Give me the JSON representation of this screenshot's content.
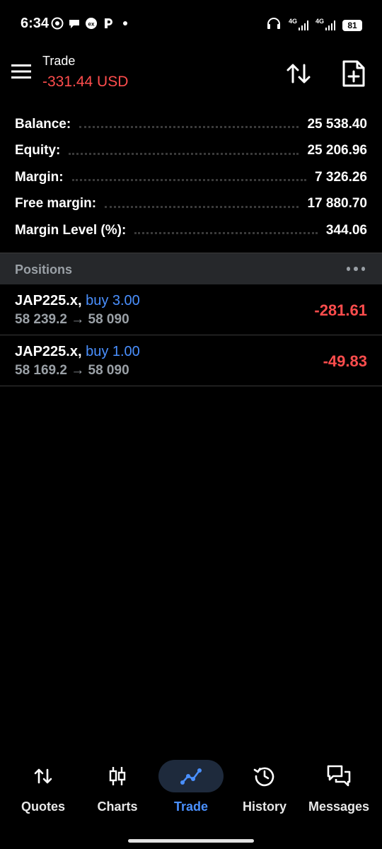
{
  "status_bar": {
    "time": "6:34",
    "net1": "4G",
    "net2": "4G",
    "battery": "81"
  },
  "header": {
    "title": "Trade",
    "profit_loss": "-331.44 USD"
  },
  "account": [
    {
      "label": "Balance:",
      "value": "25 538.40"
    },
    {
      "label": "Equity:",
      "value": "25 206.96"
    },
    {
      "label": "Margin:",
      "value": "7 326.26"
    },
    {
      "label": "Free margin:",
      "value": "17 880.70"
    },
    {
      "label": "Margin Level (%):",
      "value": "344.06"
    }
  ],
  "positions": {
    "title": "Positions",
    "items": [
      {
        "symbol": "JAP225.x,",
        "side": "buy 3.00",
        "prices": "58 239.2 → 58 090",
        "profit": "-281.61"
      },
      {
        "symbol": "JAP225.x,",
        "side": "buy 1.00",
        "prices": "58 169.2 → 58 090",
        "profit": "-49.83"
      }
    ]
  },
  "nav": {
    "quotes": "Quotes",
    "charts": "Charts",
    "trade": "Trade",
    "history": "History",
    "messages": "Messages"
  },
  "colors": {
    "loss": "#ff4d4d",
    "accent": "#4a90ff",
    "muted": "#9aa0a6"
  }
}
